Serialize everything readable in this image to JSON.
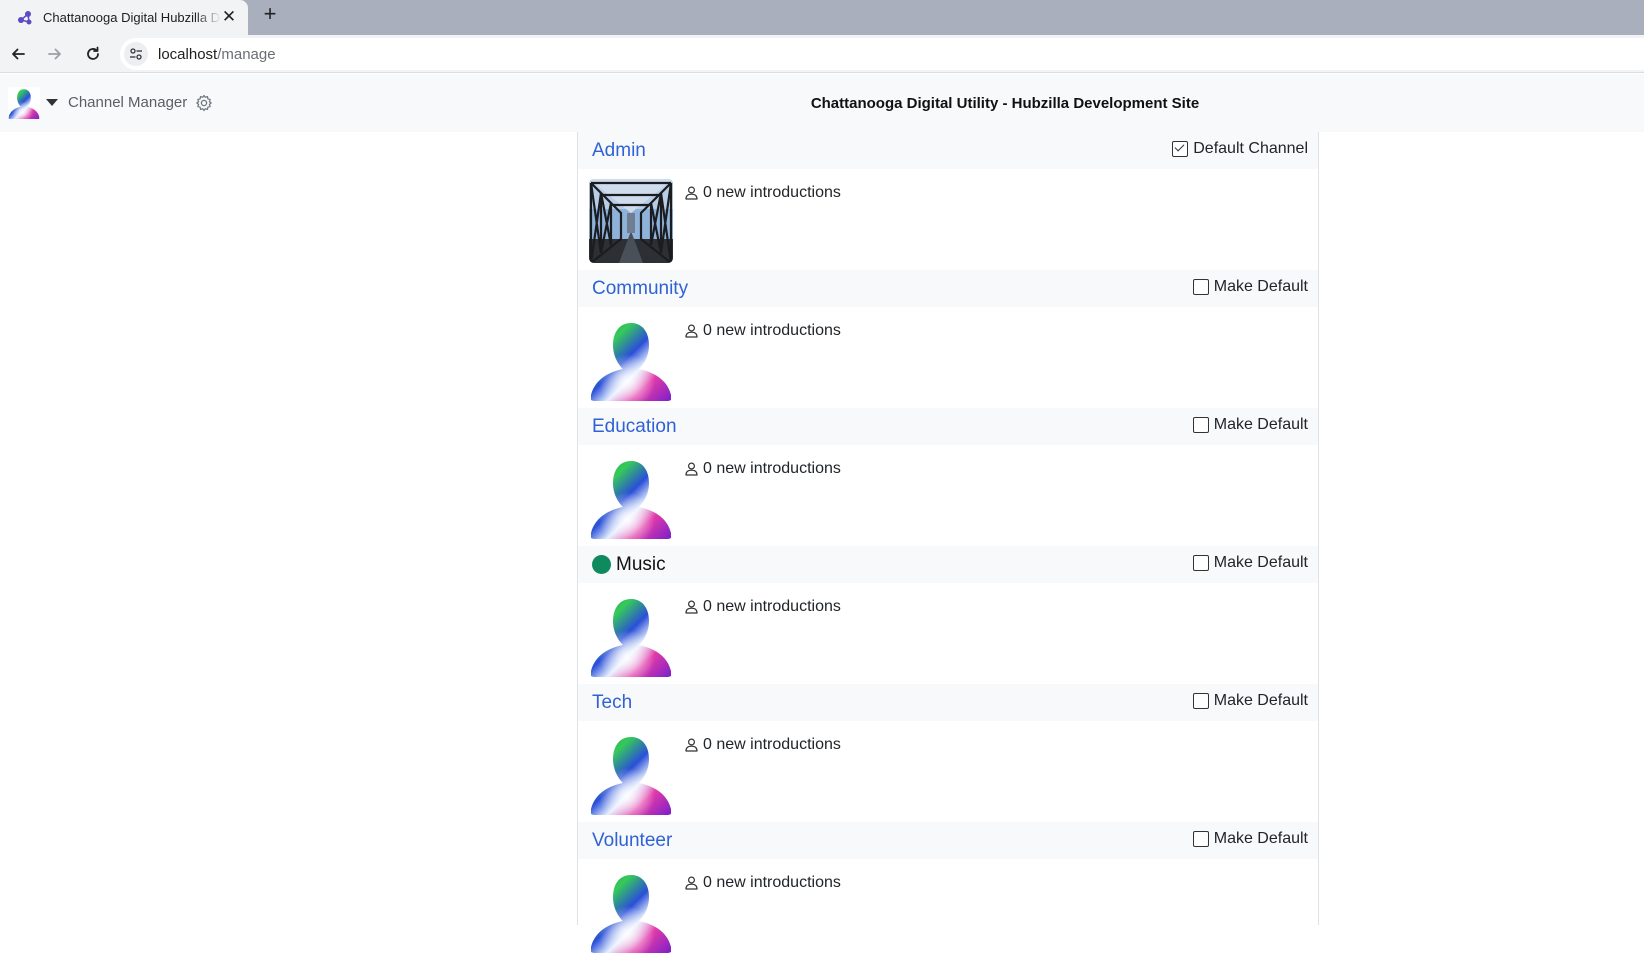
{
  "browser": {
    "tab_title": "Chattanooga Digital Hubzilla Development Site",
    "url_host": "localhost",
    "url_path": "/manage"
  },
  "navbar": {
    "page_title": "Channel Manager",
    "site_name": "Chattanooga Digital Utility - Hubzilla Development Site"
  },
  "channels": [
    {
      "name": "Admin",
      "default_label": "Default Channel",
      "is_default": true,
      "online": false,
      "introductions": "0 new introductions",
      "photo": "bridge-photo"
    },
    {
      "name": "Community",
      "default_label": "Make Default",
      "is_default": false,
      "online": false,
      "introductions": "0 new introductions",
      "photo": "default-avatar"
    },
    {
      "name": "Education",
      "default_label": "Make Default",
      "is_default": false,
      "online": false,
      "introductions": "0 new introductions",
      "photo": "default-avatar"
    },
    {
      "name": "Music",
      "default_label": "Make Default",
      "is_default": false,
      "online": true,
      "introductions": "0 new introductions",
      "photo": "default-avatar"
    },
    {
      "name": "Tech",
      "default_label": "Make Default",
      "is_default": false,
      "online": false,
      "introductions": "0 new introductions",
      "photo": "default-avatar"
    },
    {
      "name": "Volunteer",
      "default_label": "Make Default",
      "is_default": false,
      "online": false,
      "introductions": "0 new introductions",
      "photo": "default-avatar"
    }
  ],
  "colors": {
    "link": "#2f62d5",
    "online": "#0f8a5f",
    "header_bg": "#f8f9fa"
  }
}
